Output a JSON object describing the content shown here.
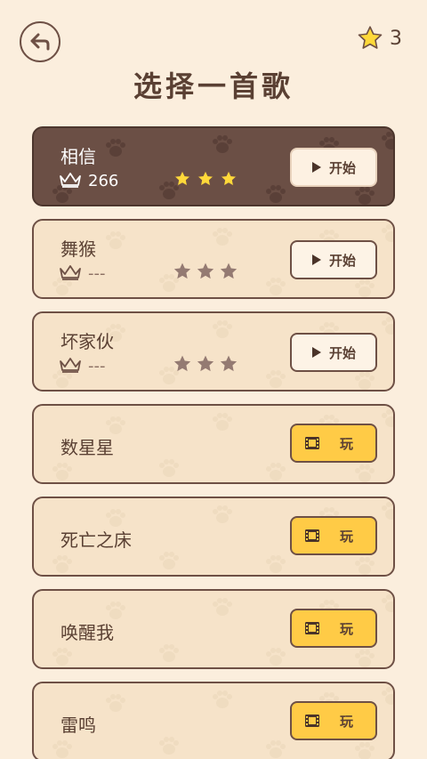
{
  "header": {
    "back_icon": "back-arrow-icon",
    "star_icon": "star-icon",
    "star_count": "3",
    "title": "选择一首歌"
  },
  "colors": {
    "background": "#fbeedd",
    "card": "#f6e3c9",
    "card_active": "#6b4f45",
    "star_filled": "#ffd93a",
    "star_empty": "#947a72",
    "play_button": "#ffcb46"
  },
  "songs": [
    {
      "name": "相信",
      "score": "266",
      "stars_earned": 3,
      "action_label": "开始",
      "state": "active"
    },
    {
      "name": "舞猴",
      "score": "---",
      "stars_earned": 0,
      "action_label": "开始",
      "state": "unlocked"
    },
    {
      "name": "坏家伙",
      "score": "---",
      "stars_earned": 0,
      "action_label": "开始",
      "state": "unlocked"
    },
    {
      "name": "数星星",
      "action_label": "玩",
      "state": "locked"
    },
    {
      "name": "死亡之床",
      "action_label": "玩",
      "state": "locked"
    },
    {
      "name": "唤醒我",
      "action_label": "玩",
      "state": "locked"
    },
    {
      "name": "雷鸣",
      "action_label": "玩",
      "state": "locked"
    }
  ]
}
